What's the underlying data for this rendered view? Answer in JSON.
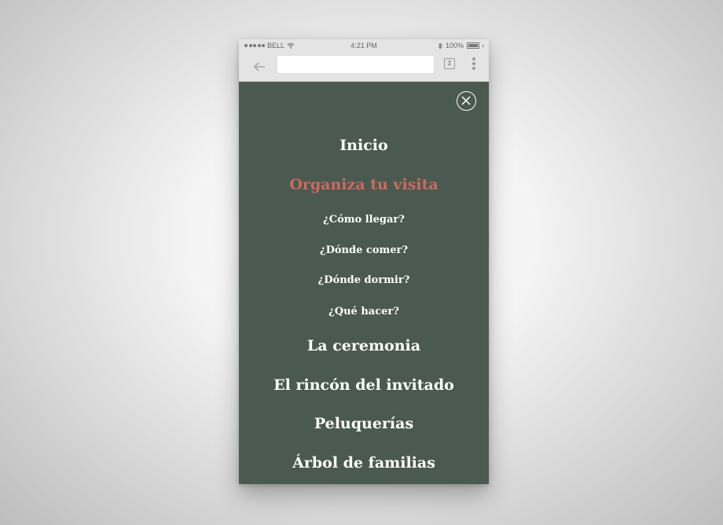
{
  "status_bar": {
    "carrier": "BELL",
    "time": "4:21 PM",
    "battery": "100%"
  },
  "browser": {
    "url_value": "",
    "tab_count": "2"
  },
  "colors": {
    "panel_bg": "#4b5a51",
    "menu_text": "#ffffff",
    "active_item": "#cc6b5c"
  },
  "menu": {
    "items": [
      {
        "label": "Inicio"
      },
      {
        "label": "Organiza tu visita"
      },
      {
        "label": "¿Cómo llegar?"
      },
      {
        "label": "¿Dónde comer?"
      },
      {
        "label": "¿Dónde dormir?"
      },
      {
        "label": "¿Qué hacer?"
      },
      {
        "label": "La ceremonia"
      },
      {
        "label": "El rincón del invitado"
      },
      {
        "label": "Peluquerías"
      },
      {
        "label": "Árbol de familias"
      }
    ]
  }
}
